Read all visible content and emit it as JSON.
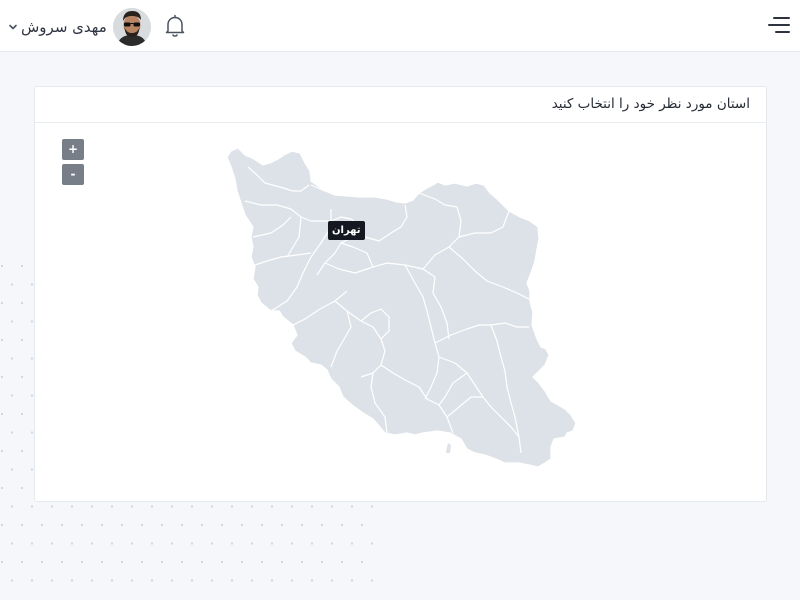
{
  "header": {
    "user_name": "مهدی سروش",
    "menu_icon": "hamburger-menu-icon",
    "notification_icon": "bell-icon",
    "dropdown_icon": "chevron-down-icon"
  },
  "card": {
    "title": "استان مورد نظر خود را انتخاب کنید",
    "zoom_in_label": "+",
    "zoom_out_label": "-",
    "tooltip_label": "تهران"
  },
  "colors": {
    "background": "#f5f7fa",
    "map_fill": "#dde2e8",
    "map_border": "#ffffff",
    "zoom_button": "#777e88",
    "tooltip": "#151820"
  }
}
